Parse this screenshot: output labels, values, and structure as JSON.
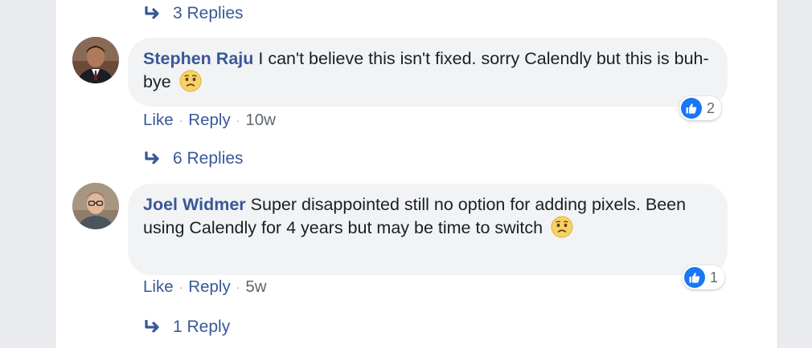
{
  "thread": {
    "top_replies_label": "3 Replies",
    "comments": [
      {
        "author": "Stephen Raju",
        "text": "I can't believe this isn't fixed. sorry Calendly but this is buh-bye",
        "emoji": "worried-face-icon",
        "like_label": "Like",
        "reply_label": "Reply",
        "time": "10w",
        "reaction_count": "2",
        "replies_label": "6 Replies"
      },
      {
        "author": "Joel Widmer",
        "text": "Super disappointed still no option for adding pixels. Been using Calendly for 4 years but may be time to switch",
        "emoji": "worried-face-icon",
        "like_label": "Like",
        "reply_label": "Reply",
        "time": "5w",
        "reaction_count": "1",
        "replies_label": "1 Reply"
      }
    ]
  },
  "colors": {
    "link_blue": "#385898",
    "bubble_bg": "#f2f3f5",
    "like_blue": "#1877f2"
  }
}
